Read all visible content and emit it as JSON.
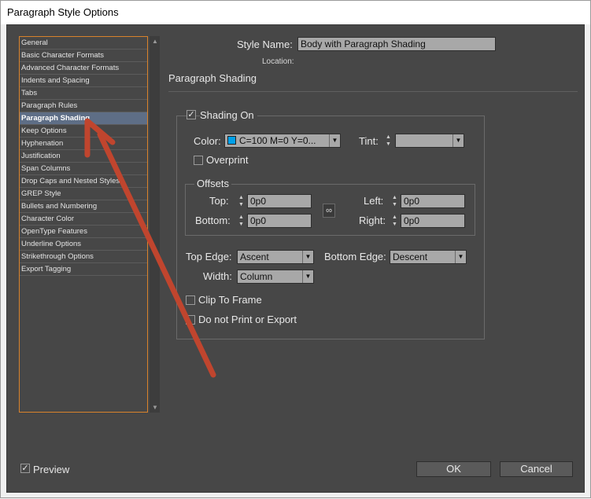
{
  "window_title": "Paragraph Style Options",
  "sidebar": {
    "items": [
      "General",
      "Basic Character Formats",
      "Advanced Character Formats",
      "Indents and Spacing",
      "Tabs",
      "Paragraph Rules",
      "Paragraph Shading",
      "Keep Options",
      "Hyphenation",
      "Justification",
      "Span Columns",
      "Drop Caps and Nested Styles",
      "GREP Style",
      "Bullets and Numbering",
      "Character Color",
      "OpenType Features",
      "Underline Options",
      "Strikethrough Options",
      "Export Tagging"
    ],
    "selected": "Paragraph Shading"
  },
  "header": {
    "style_name_label": "Style Name:",
    "style_name_value": "Body with Paragraph Shading",
    "location_label": "Location:",
    "section_title": "Paragraph Shading"
  },
  "shading": {
    "shading_on_label": "Shading On",
    "shading_on_checked": true,
    "color_label": "Color:",
    "color_value": "C=100 M=0 Y=0...",
    "color_swatch": "#00a0e9",
    "tint_label": "Tint:",
    "tint_value": "",
    "overprint_label": "Overprint",
    "offsets_label": "Offsets",
    "top_label": "Top:",
    "top_value": "0p0",
    "bottom_label": "Bottom:",
    "bottom_value": "0p0",
    "left_label": "Left:",
    "left_value": "0p0",
    "right_label": "Right:",
    "right_value": "0p0",
    "top_edge_label": "Top Edge:",
    "top_edge_value": "Ascent",
    "bottom_edge_label": "Bottom Edge:",
    "bottom_edge_value": "Descent",
    "width_label": "Width:",
    "width_value": "Column",
    "clip_label": "Clip To Frame",
    "noprint_label": "Do not Print or Export"
  },
  "footer": {
    "preview_label": "Preview",
    "preview_checked": true,
    "ok_label": "OK",
    "cancel_label": "Cancel"
  },
  "annotation": {
    "arrow_color": "#c0452e"
  }
}
